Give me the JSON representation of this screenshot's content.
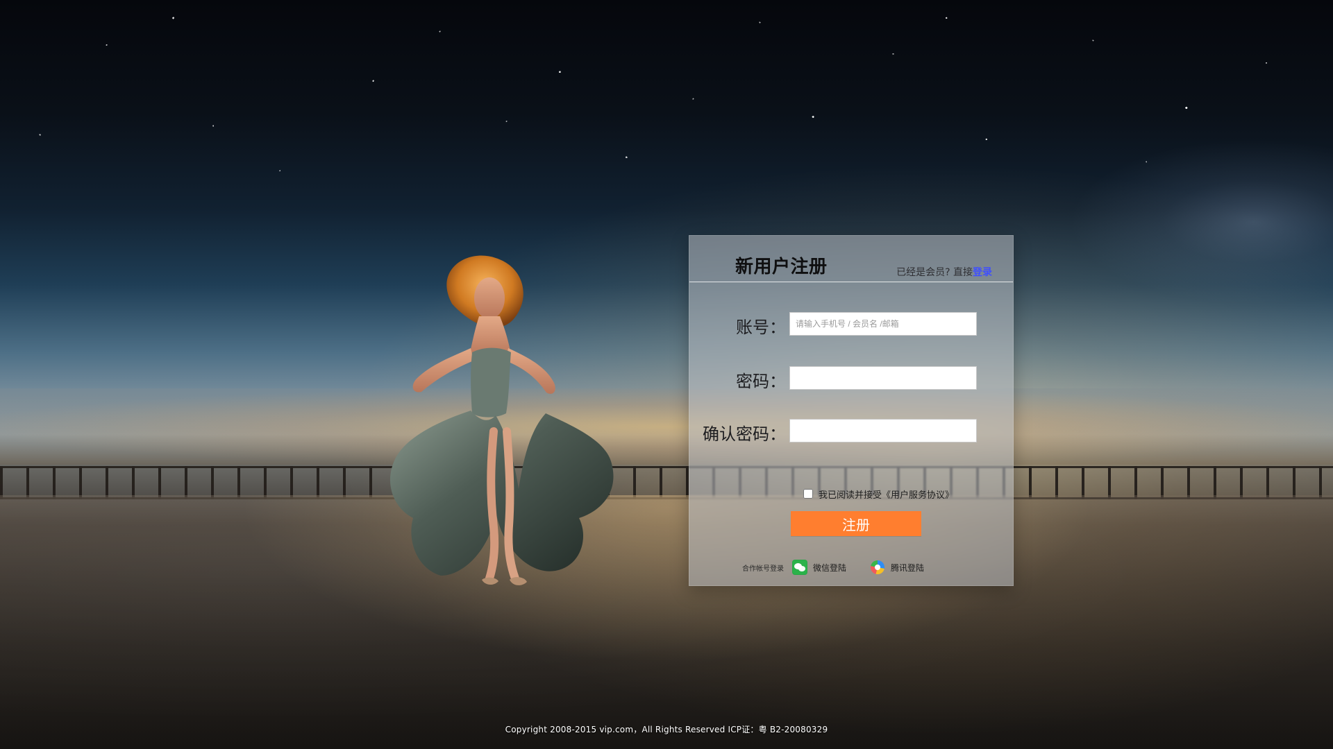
{
  "register": {
    "title": "新用户注册",
    "member_prompt_prefix": "已经是会员? 直接",
    "login_link": "登录",
    "account_label": "账号：",
    "account_placeholder": "请输入手机号 / 会员名 /邮箱",
    "password_label": "密码：",
    "confirm_password_label": "确认密码：",
    "agreement_text": "我已阅读并接受《用户服务协议》",
    "submit_label": "注册",
    "partner_caption": "合作帐号登录",
    "wechat_login": "微信登陆",
    "tencent_login": "腾讯登陆"
  },
  "footer": {
    "copyright": "Copyright 2008-2015 vip.com，All Rights Reserved ICP证：粤 B2-20080329"
  },
  "icons": {
    "wechat": "wechat-icon",
    "tencent": "tencent-icon"
  },
  "colors": {
    "accent": "#ff7e2f",
    "link": "#3f4fff"
  }
}
